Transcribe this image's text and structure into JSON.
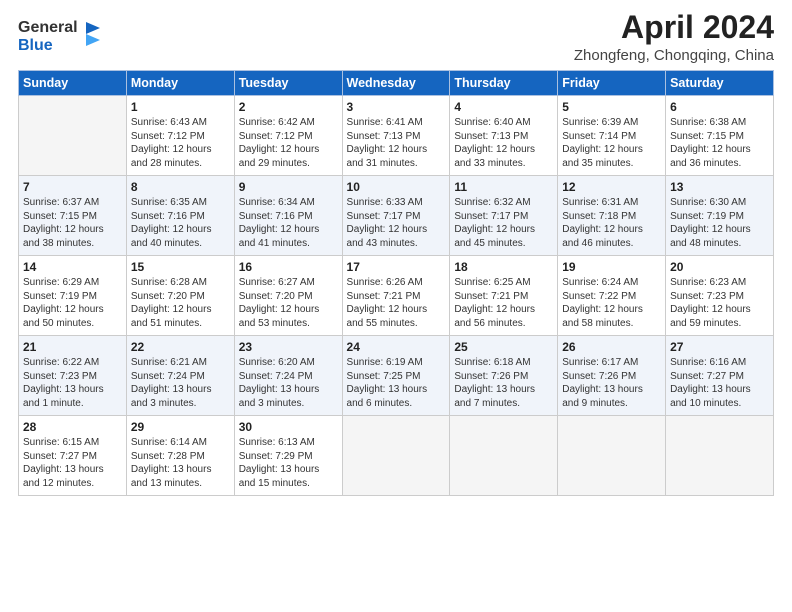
{
  "logo": {
    "line1": "General",
    "line2": "Blue"
  },
  "header": {
    "month": "April 2024",
    "location": "Zhongfeng, Chongqing, China"
  },
  "weekdays": [
    "Sunday",
    "Monday",
    "Tuesday",
    "Wednesday",
    "Thursday",
    "Friday",
    "Saturday"
  ],
  "weeks": [
    [
      {
        "day": "",
        "info": ""
      },
      {
        "day": "1",
        "info": "Sunrise: 6:43 AM\nSunset: 7:12 PM\nDaylight: 12 hours\nand 28 minutes."
      },
      {
        "day": "2",
        "info": "Sunrise: 6:42 AM\nSunset: 7:12 PM\nDaylight: 12 hours\nand 29 minutes."
      },
      {
        "day": "3",
        "info": "Sunrise: 6:41 AM\nSunset: 7:13 PM\nDaylight: 12 hours\nand 31 minutes."
      },
      {
        "day": "4",
        "info": "Sunrise: 6:40 AM\nSunset: 7:13 PM\nDaylight: 12 hours\nand 33 minutes."
      },
      {
        "day": "5",
        "info": "Sunrise: 6:39 AM\nSunset: 7:14 PM\nDaylight: 12 hours\nand 35 minutes."
      },
      {
        "day": "6",
        "info": "Sunrise: 6:38 AM\nSunset: 7:15 PM\nDaylight: 12 hours\nand 36 minutes."
      }
    ],
    [
      {
        "day": "7",
        "info": "Sunrise: 6:37 AM\nSunset: 7:15 PM\nDaylight: 12 hours\nand 38 minutes."
      },
      {
        "day": "8",
        "info": "Sunrise: 6:35 AM\nSunset: 7:16 PM\nDaylight: 12 hours\nand 40 minutes."
      },
      {
        "day": "9",
        "info": "Sunrise: 6:34 AM\nSunset: 7:16 PM\nDaylight: 12 hours\nand 41 minutes."
      },
      {
        "day": "10",
        "info": "Sunrise: 6:33 AM\nSunset: 7:17 PM\nDaylight: 12 hours\nand 43 minutes."
      },
      {
        "day": "11",
        "info": "Sunrise: 6:32 AM\nSunset: 7:17 PM\nDaylight: 12 hours\nand 45 minutes."
      },
      {
        "day": "12",
        "info": "Sunrise: 6:31 AM\nSunset: 7:18 PM\nDaylight: 12 hours\nand 46 minutes."
      },
      {
        "day": "13",
        "info": "Sunrise: 6:30 AM\nSunset: 7:19 PM\nDaylight: 12 hours\nand 48 minutes."
      }
    ],
    [
      {
        "day": "14",
        "info": "Sunrise: 6:29 AM\nSunset: 7:19 PM\nDaylight: 12 hours\nand 50 minutes."
      },
      {
        "day": "15",
        "info": "Sunrise: 6:28 AM\nSunset: 7:20 PM\nDaylight: 12 hours\nand 51 minutes."
      },
      {
        "day": "16",
        "info": "Sunrise: 6:27 AM\nSunset: 7:20 PM\nDaylight: 12 hours\nand 53 minutes."
      },
      {
        "day": "17",
        "info": "Sunrise: 6:26 AM\nSunset: 7:21 PM\nDaylight: 12 hours\nand 55 minutes."
      },
      {
        "day": "18",
        "info": "Sunrise: 6:25 AM\nSunset: 7:21 PM\nDaylight: 12 hours\nand 56 minutes."
      },
      {
        "day": "19",
        "info": "Sunrise: 6:24 AM\nSunset: 7:22 PM\nDaylight: 12 hours\nand 58 minutes."
      },
      {
        "day": "20",
        "info": "Sunrise: 6:23 AM\nSunset: 7:23 PM\nDaylight: 12 hours\nand 59 minutes."
      }
    ],
    [
      {
        "day": "21",
        "info": "Sunrise: 6:22 AM\nSunset: 7:23 PM\nDaylight: 13 hours\nand 1 minute."
      },
      {
        "day": "22",
        "info": "Sunrise: 6:21 AM\nSunset: 7:24 PM\nDaylight: 13 hours\nand 3 minutes."
      },
      {
        "day": "23",
        "info": "Sunrise: 6:20 AM\nSunset: 7:24 PM\nDaylight: 13 hours\nand 3 minutes."
      },
      {
        "day": "24",
        "info": "Sunrise: 6:19 AM\nSunset: 7:25 PM\nDaylight: 13 hours\nand 6 minutes."
      },
      {
        "day": "25",
        "info": "Sunrise: 6:18 AM\nSunset: 7:26 PM\nDaylight: 13 hours\nand 7 minutes."
      },
      {
        "day": "26",
        "info": "Sunrise: 6:17 AM\nSunset: 7:26 PM\nDaylight: 13 hours\nand 9 minutes."
      },
      {
        "day": "27",
        "info": "Sunrise: 6:16 AM\nSunset: 7:27 PM\nDaylight: 13 hours\nand 10 minutes."
      }
    ],
    [
      {
        "day": "28",
        "info": "Sunrise: 6:15 AM\nSunset: 7:27 PM\nDaylight: 13 hours\nand 12 minutes."
      },
      {
        "day": "29",
        "info": "Sunrise: 6:14 AM\nSunset: 7:28 PM\nDaylight: 13 hours\nand 13 minutes."
      },
      {
        "day": "30",
        "info": "Sunrise: 6:13 AM\nSunset: 7:29 PM\nDaylight: 13 hours\nand 15 minutes."
      },
      {
        "day": "",
        "info": ""
      },
      {
        "day": "",
        "info": ""
      },
      {
        "day": "",
        "info": ""
      },
      {
        "day": "",
        "info": ""
      }
    ]
  ]
}
